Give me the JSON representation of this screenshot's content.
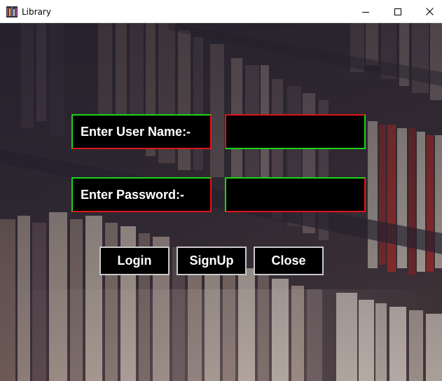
{
  "window": {
    "title": "Library",
    "icon": "library-app-icon",
    "controls": [
      "minimize-icon",
      "maximize-icon",
      "close-icon"
    ]
  },
  "form": {
    "username_label": "Enter User Name:-",
    "username_value": "",
    "password_label": "Enter Password:-",
    "password_value": ""
  },
  "buttons": {
    "login": "Login",
    "signup": "SignUp",
    "close": "Close"
  },
  "colors": {
    "field_background": "#000000",
    "border_green": "#19d419",
    "border_red": "#e01515",
    "button_border": "#c9c9c9",
    "text": "#ffffff"
  }
}
